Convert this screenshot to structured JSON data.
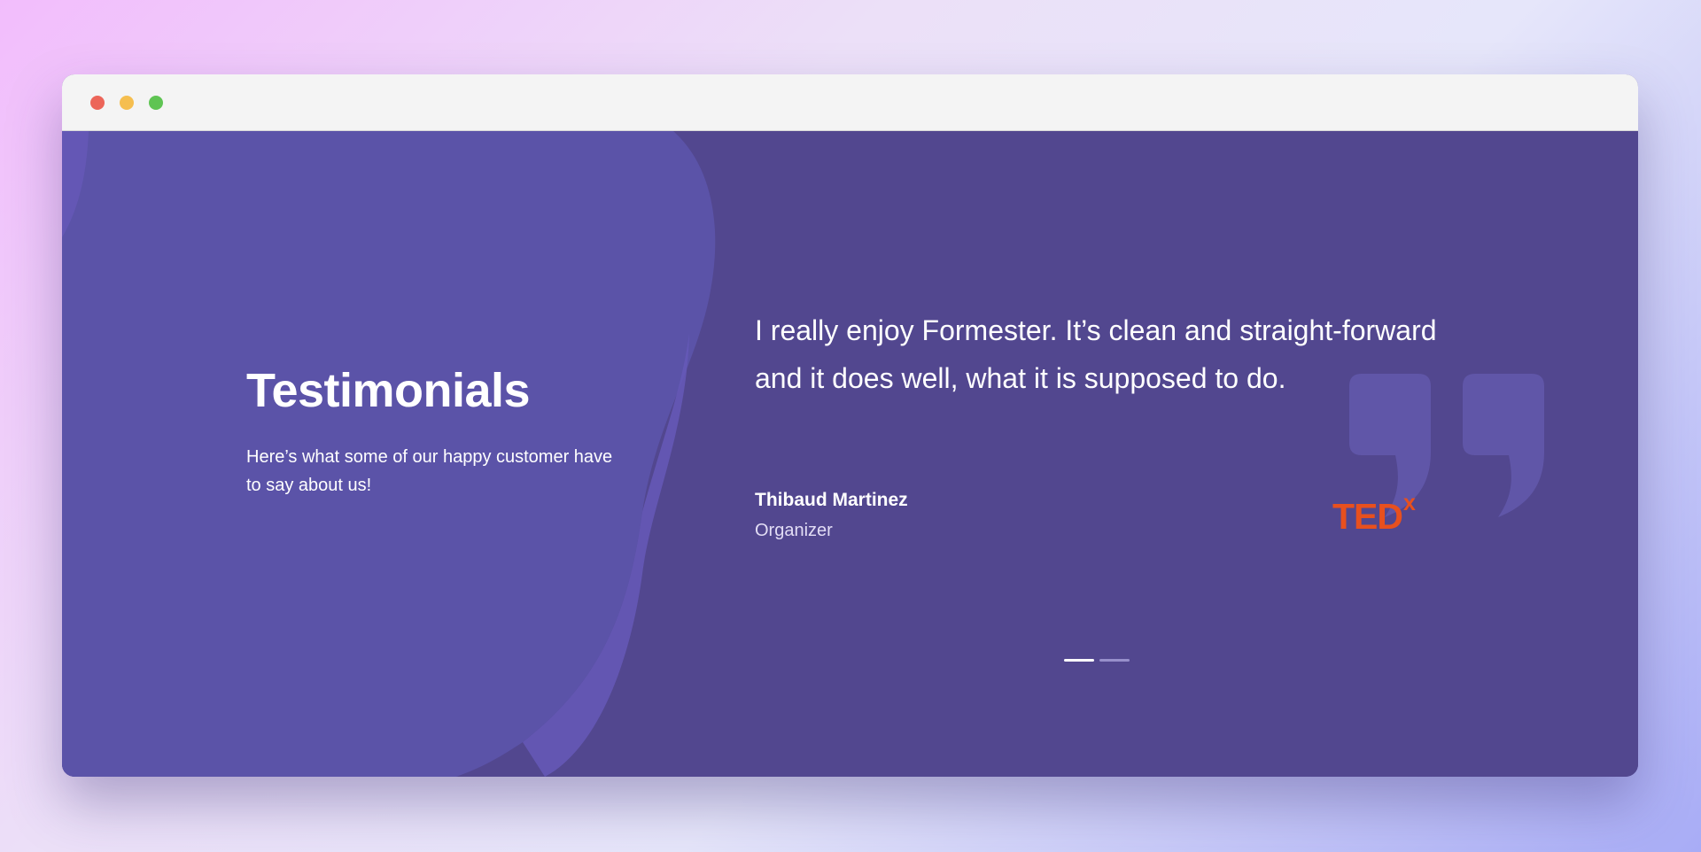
{
  "window": {
    "controls": [
      "close",
      "minimize",
      "maximize"
    ]
  },
  "section": {
    "title": "Testimonials",
    "subtitle": "Here’s what some of our happy customer have to say about us!"
  },
  "testimonial": {
    "quote": "I really enjoy Formester. It’s clean and straight-forward and it does well, what it is supposed to do.",
    "author_name": "Thibaud Martinez",
    "author_role": "Organizer",
    "company_logo": {
      "text": "TED",
      "superscript": "x",
      "color": "#e8501e"
    }
  },
  "pagination": {
    "total": 2,
    "active_index": 0
  },
  "colors": {
    "background": "#52478f",
    "blob": "#5b53a8",
    "accent_logo": "#e8501e"
  },
  "icons": {
    "quote_mark": "closing-quote-icon"
  }
}
